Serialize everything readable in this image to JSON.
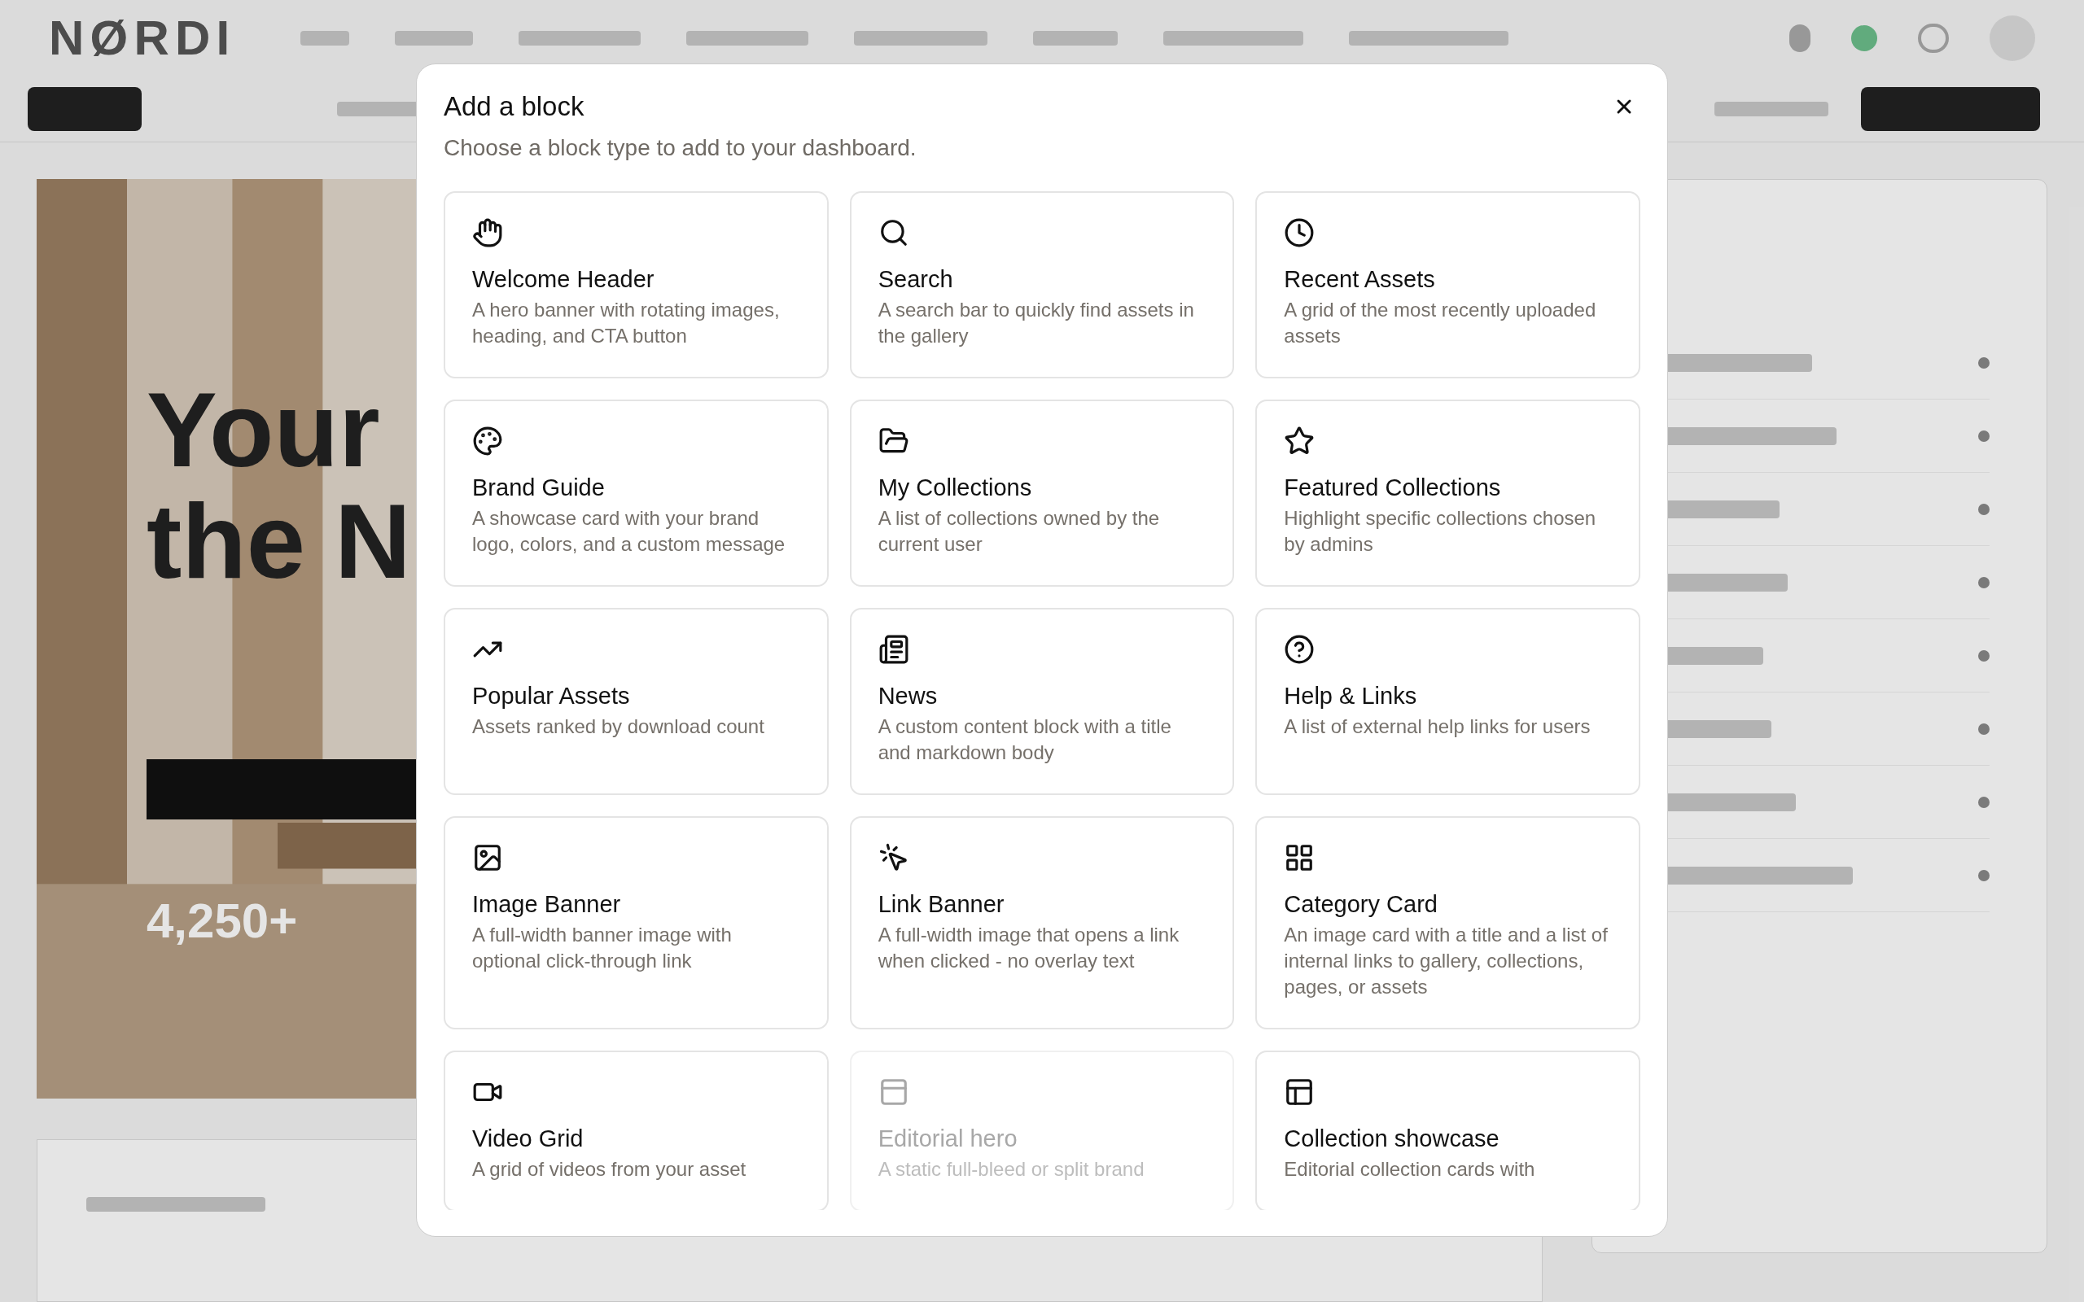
{
  "background": {
    "logo": "NØRDI",
    "hero": {
      "heading_1": "Your",
      "heading_2": "the N",
      "stat": "4,250+"
    }
  },
  "dialog": {
    "title": "Add a block",
    "subtitle": "Choose a block type to add to your dashboard.",
    "blocks": [
      {
        "title": "Welcome Header",
        "description": "A hero banner with rotating images, heading, and CTA button",
        "disabled": false
      },
      {
        "title": "Search",
        "description": "A search bar to quickly find assets in the gallery",
        "disabled": false
      },
      {
        "title": "Recent Assets",
        "description": "A grid of the most recently uploaded assets",
        "disabled": false
      },
      {
        "title": "Brand Guide",
        "description": "A showcase card with your brand logo, colors, and a custom message",
        "disabled": false
      },
      {
        "title": "My Collections",
        "description": "A list of collections owned by the current user",
        "disabled": false
      },
      {
        "title": "Featured Collections",
        "description": "Highlight specific collections chosen by admins",
        "disabled": false
      },
      {
        "title": "Popular Assets",
        "description": "Assets ranked by download count",
        "disabled": false
      },
      {
        "title": "News",
        "description": "A custom content block with a title and markdown body",
        "disabled": false
      },
      {
        "title": "Help & Links",
        "description": "A list of external help links for users",
        "disabled": false
      },
      {
        "title": "Image Banner",
        "description": "A full-width banner image with optional click-through link",
        "disabled": false
      },
      {
        "title": "Link Banner",
        "description": "A full-width image that opens a link when clicked - no overlay text",
        "disabled": false
      },
      {
        "title": "Category Card",
        "description": "An image card with a title and a list of internal links to gallery, collections, pages, or assets",
        "disabled": false
      },
      {
        "title": "Video Grid",
        "description": "A grid of videos from your asset",
        "disabled": false
      },
      {
        "title": "Editorial hero",
        "description": "A static full-bleed or split brand",
        "disabled": true
      },
      {
        "title": "Collection showcase",
        "description": "Editorial collection cards with",
        "disabled": false
      }
    ]
  }
}
